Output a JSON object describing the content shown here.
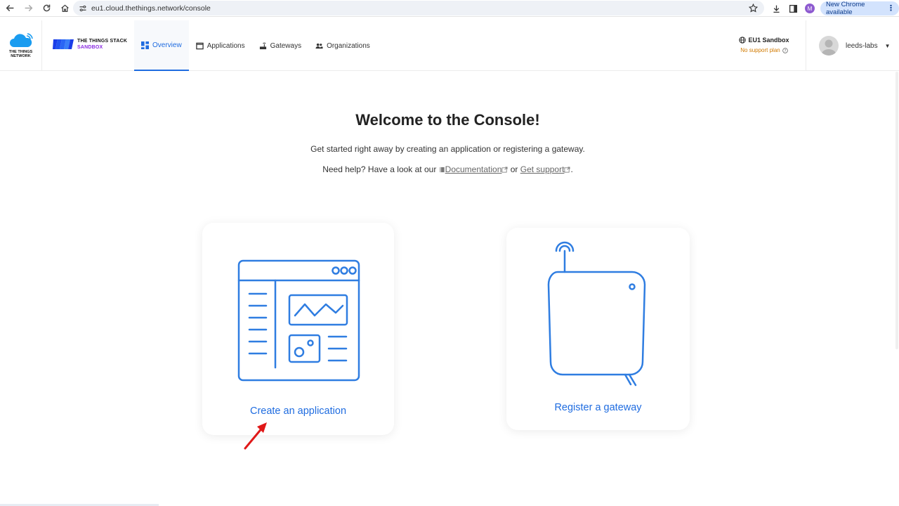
{
  "browser": {
    "url": "eu1.cloud.thethings.network/console",
    "new_chrome_label": "New Chrome available",
    "profile_initial": "M"
  },
  "header": {
    "ttn_logo_text": "THE THINGS NETWORK",
    "tts_line1": "THE THINGS STACK",
    "tts_line2": "SANDBOX",
    "nav": [
      {
        "label": "Overview",
        "active": true
      },
      {
        "label": "Applications",
        "active": false
      },
      {
        "label": "Gateways",
        "active": false
      },
      {
        "label": "Organizations",
        "active": false
      }
    ],
    "cluster_name": "EU1 Sandbox",
    "support_plan": "No support plan",
    "username": "leeds-labs"
  },
  "main": {
    "title": "Welcome to the Console!",
    "subtitle": "Get started right away by creating an application or registering a gateway.",
    "help_prefix": "Need help? Have a look at our",
    "doc_link": "Documentation",
    "or_text": "or",
    "support_link": "Get support",
    "period": ".",
    "cards": [
      {
        "label": "Create an application",
        "icon": "application-illustration"
      },
      {
        "label": "Register a gateway",
        "icon": "gateway-illustration"
      }
    ]
  },
  "colors": {
    "accent": "#1f6ce0",
    "support_plan": "#d17a00",
    "sandbox": "#8a2be2",
    "annotation_arrow": "#e01818"
  }
}
